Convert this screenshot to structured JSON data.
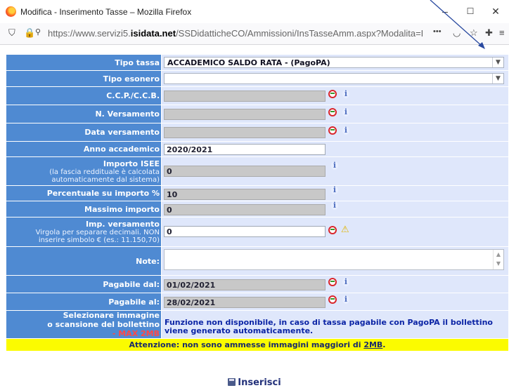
{
  "window": {
    "title": "Modifica - Inserimento Tasse – Mozilla Firefox",
    "minimize": "–",
    "maximize": "☐",
    "close": "✕"
  },
  "addressbar": {
    "url_prefix": "https://www.servizi5.",
    "url_domain": "isidata.net",
    "url_path": "/SSDidatticheCO/Ammissioni/InsTasseAmm.aspx?Modalita=I",
    "more": "•••"
  },
  "form": {
    "tipo_tassa": {
      "label": "Tipo tassa",
      "value": "ACCADEMICO SALDO RATA - (PagoPA)"
    },
    "tipo_esonero": {
      "label": "Tipo esonero",
      "value": ""
    },
    "ccp": {
      "label": "C.C.P./C.C.B.",
      "value": ""
    },
    "n_versamento": {
      "label": "N. Versamento",
      "value": ""
    },
    "data_versamento": {
      "label": "Data versamento",
      "value": ""
    },
    "anno_accademico": {
      "label": "Anno accademico",
      "value": "2020/2021"
    },
    "importo_isee": {
      "label": "Importo ISEE",
      "sub1": "(la fascia reddituale è calcolata",
      "sub2": "automaticamente dal sistema)",
      "value": "0"
    },
    "percentuale": {
      "label": "Percentuale su importo %",
      "value": "10"
    },
    "massimo": {
      "label": "Massimo importo",
      "value": "0"
    },
    "imp_versamento": {
      "label": "Imp. versamento",
      "sub1": "Virgola per separare decimali. NON",
      "sub2": "inserire simbolo € (es.: 11.150,70)",
      "value": "0"
    },
    "note": {
      "label": "Note:",
      "value": ""
    },
    "pagabile_dal": {
      "label": "Pagabile dal:",
      "value": "01/02/2021"
    },
    "pagabile_al": {
      "label": "Pagabile al:",
      "value": "28/02/2021"
    },
    "immagine": {
      "label1": "Selezionare immagine",
      "label2": "o scansione del bollettino",
      "label3": "- MAX 2MB",
      "message": "Funzione non disponibile, in caso di tassa pagabile con PagoPA il bollettino viene generato automaticamente."
    },
    "warning_prefix": "Attenzione: non sono ammesse immagini maggiori di ",
    "warning_size": "2MB",
    "warning_suffix": ".",
    "submit_label": "Inserisci"
  },
  "icons": [
    "firefox-logo",
    "shield-icon",
    "lock-icon",
    "permissions-icon",
    "pocket-icon",
    "star-icon",
    "extension-icon",
    "menu-icon",
    "not-allowed-icon",
    "info-icon",
    "warning-icon",
    "save-icon"
  ]
}
